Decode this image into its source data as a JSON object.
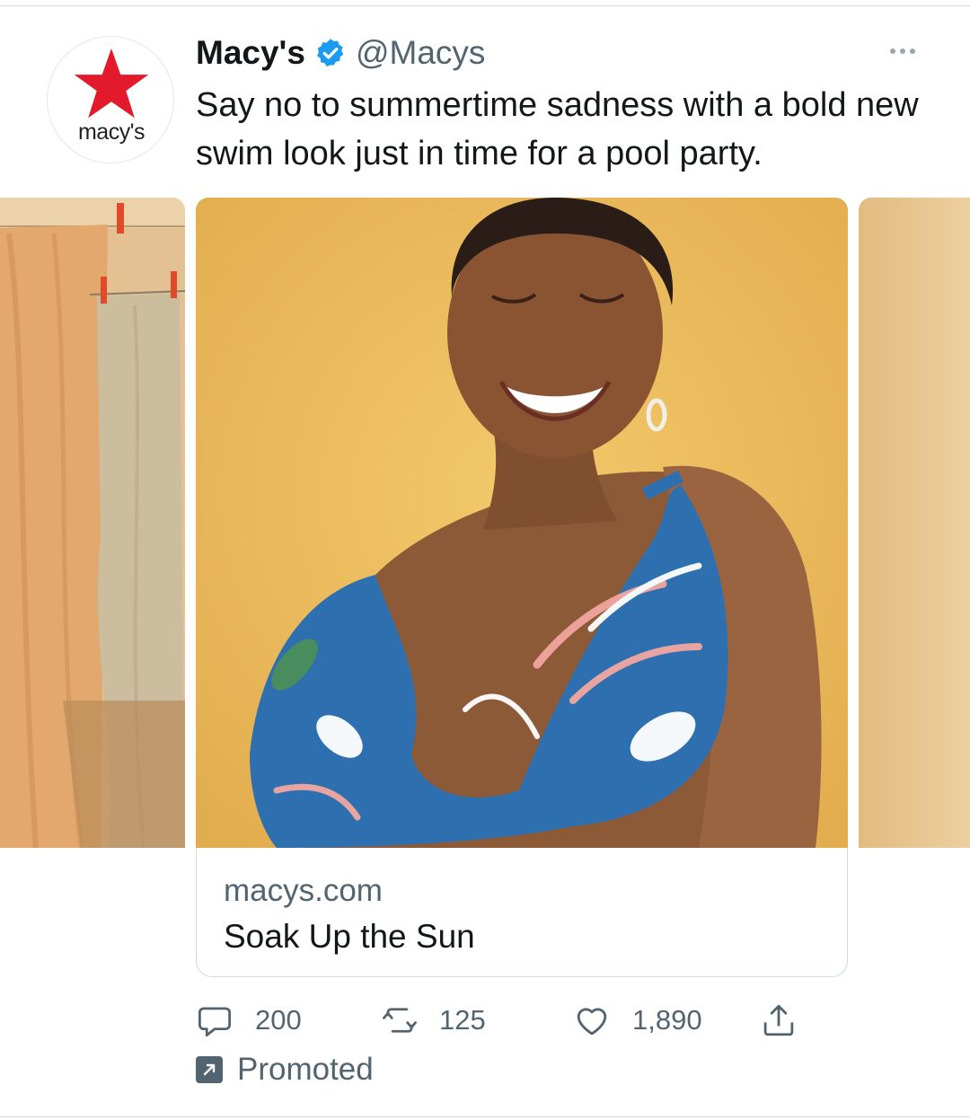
{
  "tweet": {
    "display_name": "Macy's",
    "handle": "@Macys",
    "verified_icon": "verified-badge-icon",
    "text": "Say no to summertime sadness with a bold new swim look just in time for a pool party.",
    "avatar": {
      "wordmark": "macy's",
      "star_color": "#e21a2c"
    }
  },
  "card": {
    "domain": "macys.com",
    "title": "Soak Up the Sun",
    "images": [
      {
        "name": "curtain-photo",
        "palette": [
          "#e9b883",
          "#c9b79a"
        ]
      },
      {
        "name": "swimwear-model-photo",
        "palette": [
          "#f0c060",
          "#2b6fae"
        ]
      },
      {
        "name": "yellow-backdrop-photo",
        "palette": [
          "#e7c58c"
        ]
      }
    ]
  },
  "actions": {
    "reply_count": "200",
    "retweet_count": "125",
    "like_count": "1,890"
  },
  "promoted_label": "Promoted",
  "colors": {
    "text_primary": "#14171a",
    "text_secondary": "#536471",
    "verified_blue": "#1d9bf0",
    "brand_red": "#e21a2c"
  }
}
